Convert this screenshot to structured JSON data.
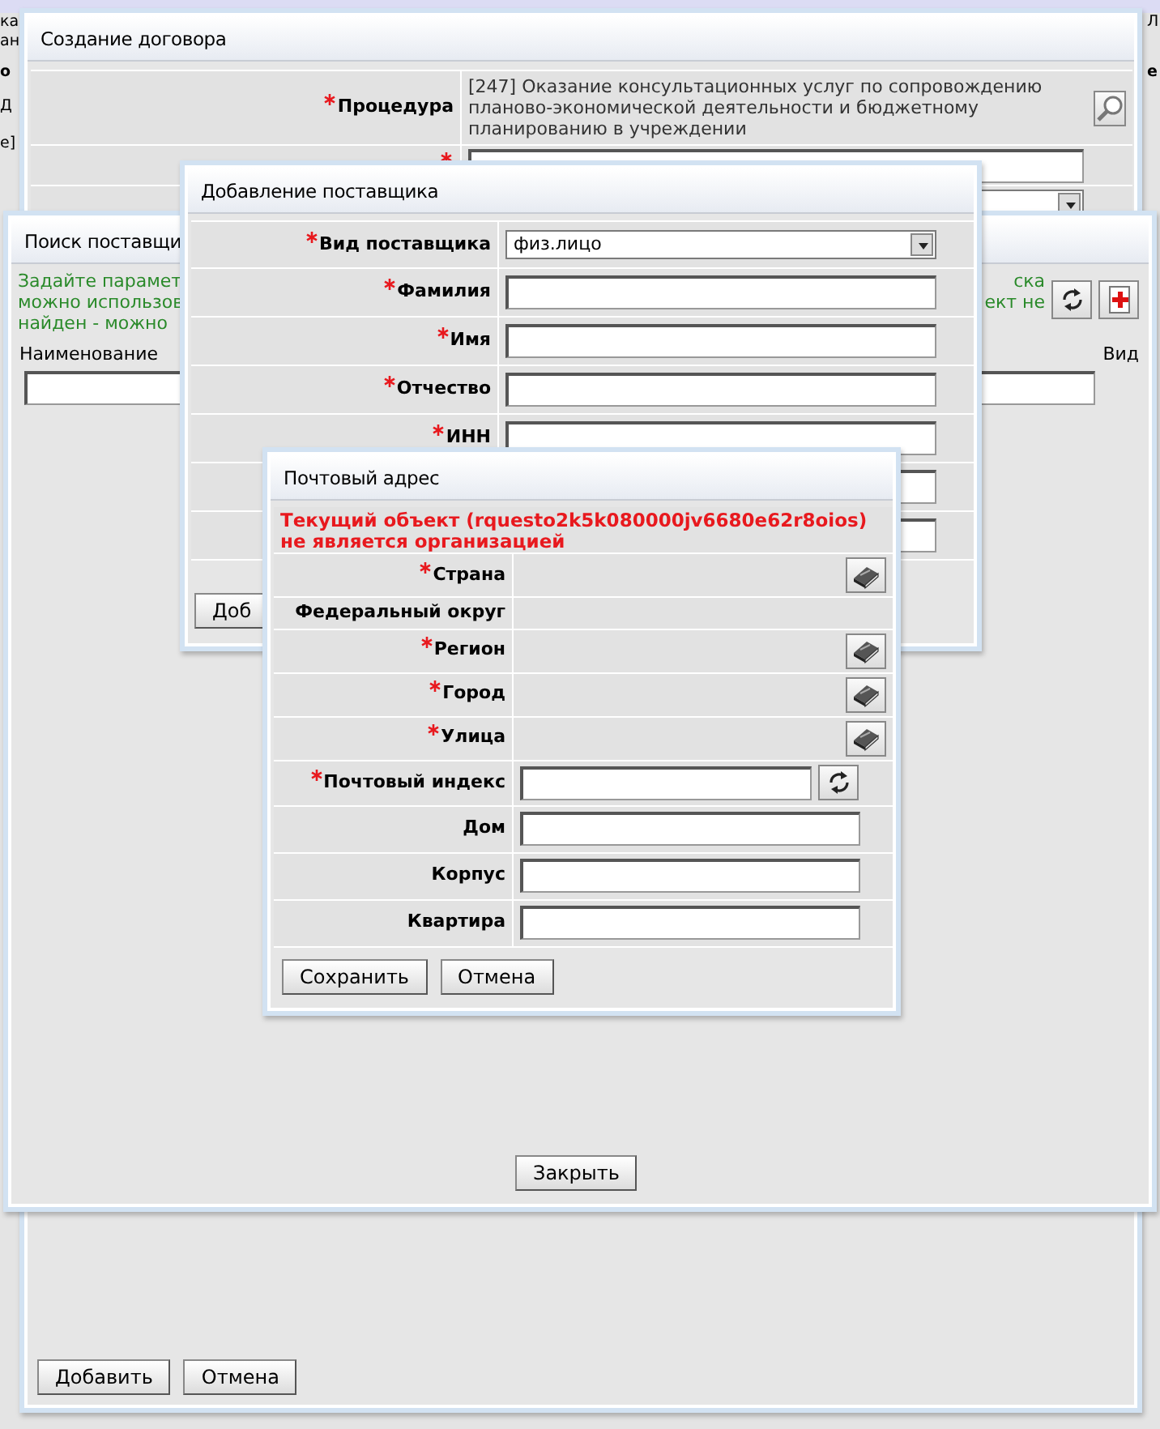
{
  "background_page": {
    "left_fragments": [
      {
        "text": "ка",
        "bold": false
      },
      {
        "text": "ан",
        "bold": false
      },
      {
        "text": "о",
        "bold": true
      },
      {
        "text": "Д",
        "bold": false
      },
      {
        "text": "е]",
        "bold": false
      }
    ],
    "right_fragments": [
      {
        "text": "Л",
        "bold": false
      },
      {
        "text": "е",
        "bold": true
      }
    ]
  },
  "contract_window": {
    "title": "Создание договора",
    "fields": [
      {
        "label": "Процедура",
        "required": true,
        "kind": "lookup",
        "value": "[247] Оказание консультационных услуг по сопровождению планово-экономической деятельности и бюджетному планированию в учреждении"
      },
      {
        "required": true,
        "kind": "input"
      },
      {
        "kind": "select"
      }
    ],
    "buttons": [
      "Добавить",
      "Отмена"
    ]
  },
  "search_window": {
    "title": "Поиск поставщи",
    "hint_left": [
      "Задайте парамет",
      "можно использов",
      "найден - можно"
    ],
    "hint_right": [
      "ска",
      "ект не"
    ],
    "columns": [
      "Наименование",
      "Вид"
    ],
    "close_button": "Закрыть"
  },
  "supplier_window": {
    "title": "Добавление поставщика",
    "fields": [
      {
        "label": "Вид поставщика",
        "required": true,
        "kind": "select",
        "value": "физ.лицо"
      },
      {
        "label": "Фамилия",
        "required": true,
        "kind": "input"
      },
      {
        "label": "Имя",
        "required": true,
        "kind": "input"
      },
      {
        "label": "Отчество",
        "required": true,
        "kind": "input"
      },
      {
        "label": "ИНН",
        "required": true,
        "kind": "input"
      },
      {
        "kind": "input"
      },
      {
        "kind": "input"
      }
    ],
    "button": "Доб"
  },
  "address_window": {
    "title": "Почтовый адрес",
    "error": "Текущий объект (rquesto2k5k080000jv6680e62r8oios) не является организацией",
    "fields": [
      {
        "label": "Страна",
        "required": true,
        "kind": "lookup"
      },
      {
        "label": "Федеральный округ",
        "required": false,
        "kind": "text"
      },
      {
        "label": "Регион",
        "required": true,
        "kind": "lookup"
      },
      {
        "label": "Город",
        "required": true,
        "kind": "lookup"
      },
      {
        "label": "Улица",
        "required": true,
        "kind": "lookup"
      },
      {
        "label": "Почтовый индекс",
        "required": true,
        "kind": "refresh_input"
      },
      {
        "label": "Дом",
        "required": false,
        "kind": "input"
      },
      {
        "label": "Корпус",
        "required": false,
        "kind": "input"
      },
      {
        "label": "Квартира",
        "required": false,
        "kind": "input"
      }
    ],
    "buttons": [
      "Сохранить",
      "Отмена"
    ]
  }
}
